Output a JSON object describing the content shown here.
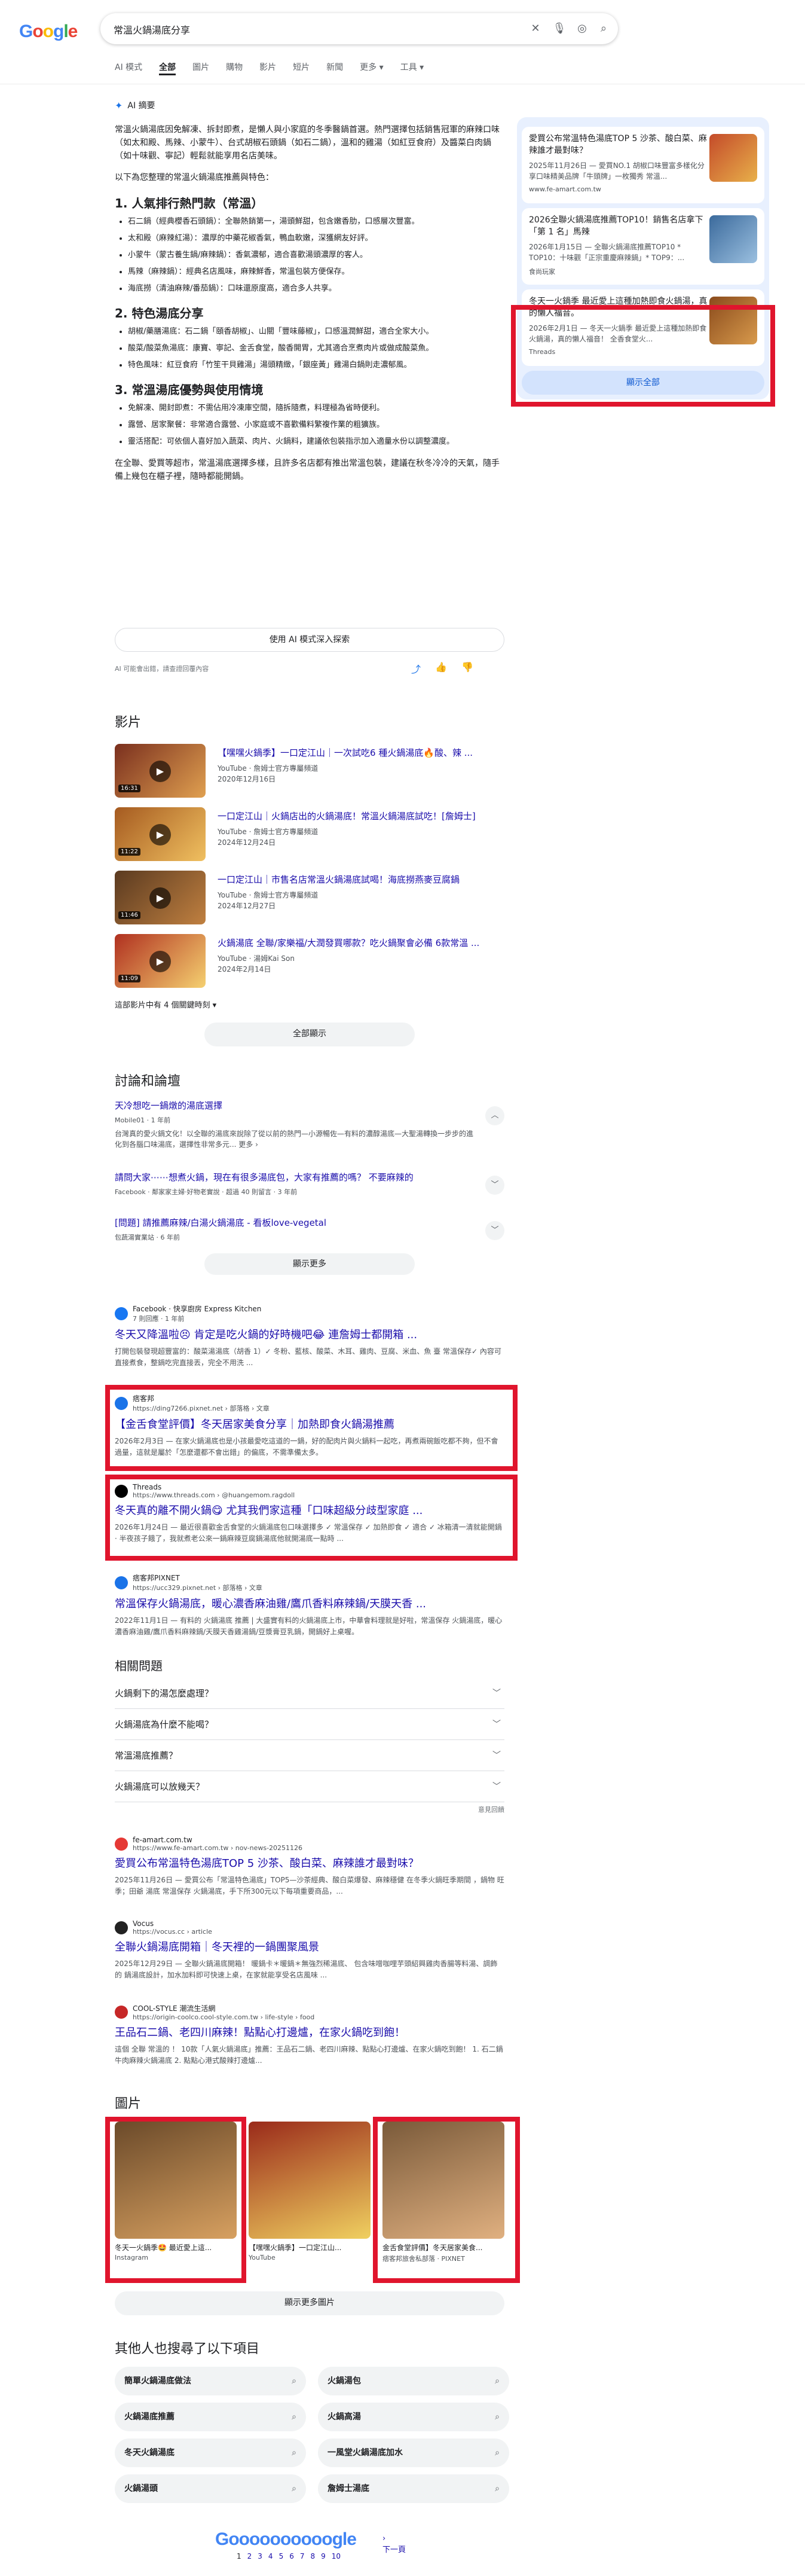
{
  "search": {
    "query": "常溫火鍋湯底分享"
  },
  "tabs": [
    "AI 模式",
    "全部",
    "圖片",
    "購物",
    "影片",
    "短片",
    "新聞",
    "更多",
    "工具"
  ],
  "ai": {
    "header": "AI 摘要",
    "intro": "常溫火鍋湯底因免解凍、拆封即煮，是懶人與小家庭的冬季醫鍋首選。熱門選擇包括銷售冠軍的麻辣口味（如太和殿、馬辣、小蒙牛）、台式胡椒石頭鍋（如石二鍋），溫和的雞湯（如紅豆食府）及醬菜白肉鍋（如十味觀、寧記）輕鬆就能享用名店美味。",
    "lead": "以下為您整理的常溫火鍋湯底推薦與特色：",
    "s1": "1. 人氣排行熱門款（常溫）",
    "s1items": [
      "石二鍋（經典櫻香石頭鍋）：全聯熱銷第一，湯頭鮮甜，包含嫩香肋，口感層次豐富。",
      "太和殿（麻辣紅湯）：濃厚的中藥花椒香氣，鴨血軟嫩，深獲網友好評。",
      "小蒙牛（蒙古養生鍋/麻辣鍋）：香氣濃郁，適合喜歡湯頭濃厚的客人。",
      "馬辣（麻辣鍋）：經典名店風味，麻辣鮮香，常溫包裝方便保存。",
      "海底撈（清油麻辣/番茄鍋）：口味還原度高，適合多人共享。"
    ],
    "s2": "2. 特色湯底分享",
    "s2items": [
      "胡椒/藥膳湯底：石二鍋「頤香胡椒」、山關「豐味藤椒」，口感溫潤鮮甜，適合全家大小。",
      "酸菜/酸菜魚湯底：康寶、寧記、金舌食堂，酸香開胃，尤其適合烹煮肉片或做成酸菜魚。",
      "特色風味：紅豆食府「竹笙干貝雞湯」湯頭精緻，「銀座黃」雞湯白鍋則走濃郁風。"
    ],
    "s3": "3. 常溫湯底優勢與使用情境",
    "s3items": [
      "免解凍、開封即煮：不需佔用冷凍庫空間，隨拆隨煮，料理極為省時便利。",
      "露營、居家聚餐：非常適合露營、小家庭或不喜歡備料繁複作業的粗獷族。",
      "靈活搭配：可依個人喜好加入蔬菜、肉片、火鍋料，建議依包裝指示加入適量水份以調整濃度。"
    ],
    "outro": "在全聯、愛買等超市，常溫湯底選擇多樣，且許多名店都有推出常溫包裝，建議在秋冬冷冷的天氣，隨手備上幾包在櫃子裡，隨時都能開鍋。",
    "dive": "使用 AI 模式深入探索",
    "disclaimer": "AI 可能會出錯，請查證回覆內容"
  },
  "side": {
    "cards": [
      {
        "t": "愛買公布常溫特色湯底TOP 5 沙茶、酸白菜、麻辣誰才最對味？",
        "d": "2025年11月26日 — 愛買NO.1 胡椒口味豐富多樣化分享口味精美品牌「牛頭牌」一枚獨秀 常溫...",
        "src": "www.fe-amart.com.tw"
      },
      {
        "t": "2026全聯火鍋湯底推薦TOP10！銷售名店拿下「第 1 名」馬辣",
        "d": "2026年1月15日 — 全聯火鍋湯底推薦TOP10 * TOP10：十味觀「正宗重慶麻辣鍋」* TOP9：...",
        "src": "食尚玩家"
      },
      {
        "t": "冬天一火鍋季 最近愛上這種加熱即食火鍋湯，真的懶人福音。",
        "d": "2026年2月1日 — 冬天一火鍋季 最近愛上這種加熱即食火鍋湯，真的懶人福音！ 全香食堂火...",
        "src": "Threads"
      }
    ],
    "show_all": "顯示全部"
  },
  "videos": {
    "title": "影片",
    "items": [
      {
        "t": "【嘿嘿火鍋季】一口定江山｜一次試吃6 種火鍋湯底🔥酸、辣 ...",
        "s": "YouTube · 詹姆士官方專屬頻道",
        "dt": "2020年12月16日",
        "dur": "16:31"
      },
      {
        "t": "一口定江山｜火鍋店出的火鍋湯底！常溫火鍋湯底試吃！[詹姆士]",
        "s": "YouTube · 詹姆士官方專屬頻道",
        "dt": "2024年12月24日",
        "dur": "11:22"
      },
      {
        "t": "一口定江山｜市售名店常溫火鍋湯底試喝！海底撈燕麥豆腐鍋",
        "s": "YouTube · 詹姆士官方專屬頻道",
        "dt": "2024年12月27日",
        "dur": "11:46"
      },
      {
        "t": "火鍋湯底 全聯/家樂福/大潤發買哪款？吃火鍋聚會必備 6款常溫 ...",
        "s": "YouTube · 湯姆Kai Son",
        "dt": "2024年2月14日",
        "dur": "11:09"
      }
    ],
    "more": "這部影片中有 4 個關鍵時刻",
    "show_all": "全部顯示"
  },
  "discussions": {
    "title": "討論和論壇",
    "items": [
      {
        "t": "天冷想吃一鍋燉的湯底選擇",
        "s": "Mobile01 · 1 年前",
        "d": "台灣真的愛火鍋文化！以全聯的湯底來說除了從以前的熱門—小源暢佐—有料的濃醇湯底—大聖湯轉換一步步的進化到各腦口味湯底，選擇性非常多元... 更多 ›"
      },
      {
        "t": "請問大家⋯⋯想煮火鍋，現在有很多湯底包，大家有推薦的嗎？ 不要麻辣的",
        "s": "Facebook · 鄰家家主婦·好物老實說 · 超過 40 則留言 · 3 年前",
        "d": ""
      },
      {
        "t": "[問題] 請推薦麻辣/白湯火鍋湯底 - 看板love-vegetal",
        "s": "包蔬湯實業站 · 6 年前",
        "d": ""
      }
    ],
    "show_more": "顯示更多"
  },
  "results": [
    {
      "site": "Facebook · 快享廚房 Express Kitchen",
      "url": "7 則回應 · 1 年前",
      "t": "冬天又降溫啦😣 肯定是吃火鍋的好時機吧😂 連詹姆士都開箱 ...",
      "d": "打開包裝發現超豐富的：酸菜湯湯底（胡香 1）✓ 冬粉、藍核、酸菜、木耳、雞肉、豆腐、米血、魚 臺 常溫保存✓ 內容可直接煮食，整鍋吃完直接丟，完全不用洗 ..."
    },
    {
      "site": "痞客邦",
      "url": "https://ding7266.pixnet.net › 部落格 › 文章",
      "t": "【金舌食堂評價】冬天居家美食分享｜加熱即食火鍋湯推薦",
      "d": "2026年2月3日 — 在家火鍋湯底也是小孩最愛吃這道的一鍋，好的配肉片與火鍋料一起吃，再煮兩碗飯吃都不夠，但不會過量，這就是屬於「怎麼還都不會出錯」的偏底，不需準備太多。"
    },
    {
      "site": "Threads",
      "url": "https://www.threads.com › @huangemom.ragdoll",
      "t": "冬天真的離不開火鍋😋 尤其我們家這種「口味超級分歧型家庭 ...",
      "d": "2026年1月24日 — 最近很喜歡金舌食堂的火鍋湯底包口味選擇多 ✓ 常溫保存 ✓ 加熱即食 ✓ 適合 ✓ 冰箱清一清就能開鍋 · 半夜孩子餓了，我就煮老公來一鍋麻辣豆腐鍋湯底他就開湯底一點時 ..."
    },
    {
      "site": "痞客邦PIXNET",
      "url": "https://ucc329.pixnet.net › 部落格 › 文章",
      "t": "常溫保存火鍋湯底，暖心濃香麻油雞/鷹爪香料麻辣鍋/天膜天香 ...",
      "d": "2022年11月1日 — 有料的 火鍋湯底 推薦 | 大盛實有料的火鍋湯底上市，中華會料理就是好啦，常溫保存 火鍋湯底，暖心濃香麻油雞/鷹爪香料麻辣鍋/天膜天香雞湯鍋/豆漿膏豆乳鍋，開鍋好上桌喔。"
    }
  ],
  "paa": {
    "title": "相關問題",
    "items": [
      "火鍋剩下的湯怎麼處理？",
      "火鍋湯底為什麼不能喝？",
      "常溫湯底推薦？",
      "火鍋湯底可以放幾天？"
    ],
    "feedback": "意見回饋"
  },
  "results2": [
    {
      "site": "fe-amart.com.tw",
      "url": "https://www.fe-amart.com.tw › nov-news-20251126",
      "t": "愛買公布常溫特色湯底TOP 5 沙茶、酸白菜、麻辣誰才最對味？",
      "d": "2025年11月26日 — 愛買公布「常溫特色湯底」TOP5—沙茶經典、酸白菜爆發、麻辣穩健 在冬季火鍋旺季期間 ，鍋物 旺季；田爺 湯底 常溫保存 火鍋湯底，手下所300元以下每項重要商品，..."
    },
    {
      "site": "Vocus",
      "url": "https://vocus.cc › article",
      "t": "全聯火鍋湯底開箱｜冬天裡的一鍋團聚風景",
      "d": "2025年12月29日 — 全聯火鍋湯底開箱！ 暖鍋卡＊暖鍋＊無強烈稀湯底、 包含味噌咖哩芋頭紹興雞肉香腸等料湯、調飾的 鍋湯底設計，加水加料即可快速上桌，在家就能享受名店風味 ..."
    },
    {
      "site": "COOL-STYLE 潮流生活網",
      "url": "https://origin-coolco.cool-style.com.tw › life-style › food",
      "t": "王品石二鍋、老四川麻辣！點點心打邊爐，在家火鍋吃到飽！",
      "d": "這個 全聯 常溫的 ！ 10款「人氣火鍋湯底」推薦：王品石二鍋、老四川麻辣、點點心打邊爐、在家火鍋吃到飽！ 1. 石二鍋牛肉麻辣火鍋湯底 2. 點點心港式酸辣打邊爐..."
    }
  ],
  "images": {
    "title": "圖片",
    "items": [
      {
        "cap": "冬天一火鍋季🤩 最近愛上這...",
        "src": "Instagram",
        "color": "#e1306c"
      },
      {
        "cap": "【嘿嘿火鍋季】一口定江山...",
        "src": "YouTube",
        "color": "#ff0000"
      },
      {
        "cap": "金舌食堂評價】冬天居家美食...",
        "src": "痞客邦旅舍私部落 · PIXNET",
        "color": "#1a73e8"
      }
    ],
    "more": "顯示更多圖片"
  },
  "related": {
    "title": "其他人也搜尋了以下項目",
    "items": [
      "簡單火鍋湯底做法",
      "火鍋湯包",
      "火鍋湯底推薦",
      "火鍋高湯",
      "冬天火鍋湯底",
      "一風堂火鍋湯底加水",
      "火鍋湯頭",
      "詹姆士湯底"
    ]
  },
  "pager": {
    "letters": "Goooooooooogle",
    "pages": [
      "1",
      "2",
      "3",
      "4",
      "5",
      "6",
      "7",
      "8",
      "9",
      "10"
    ],
    "next": "下一頁"
  }
}
